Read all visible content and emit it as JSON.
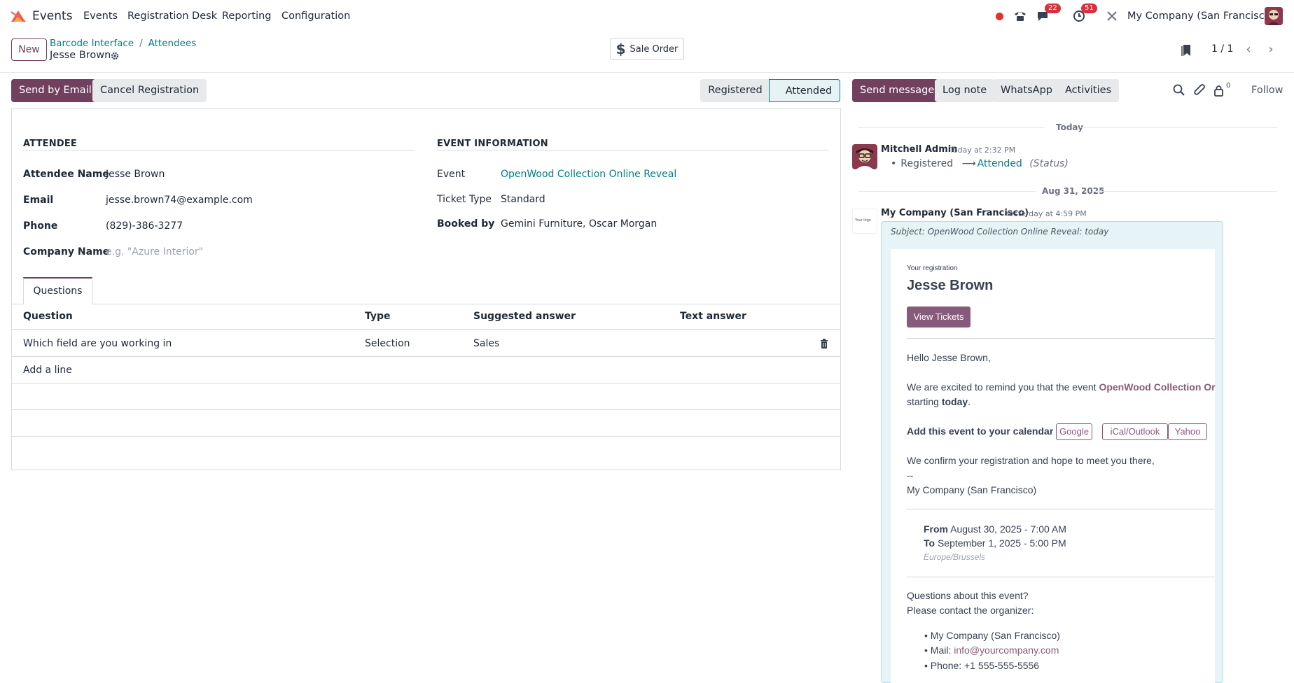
{
  "app": {
    "name": "Events"
  },
  "menu": [
    "Events",
    "Registration Desk",
    "Reporting",
    "Configuration"
  ],
  "systray": {
    "messages_badge": "22",
    "activities_badge": "51",
    "company": "My Company (San Francisco)"
  },
  "control": {
    "new_label": "New",
    "breadcrumb": [
      "Barcode Interface",
      "Attendees"
    ],
    "breadcrumb_sep": "/",
    "record_title": "Jesse Brown",
    "sale_order_label": "Sale Order",
    "pager": "1 / 1"
  },
  "statusbar": {
    "send_email": "Send by Email",
    "cancel": "Cancel Registration",
    "stages": [
      "Registered",
      "Attended"
    ],
    "active_stage": "Attended"
  },
  "form": {
    "attendee_section": "ATTENDEE",
    "event_section": "EVENT INFORMATION",
    "fields": {
      "name_label": "Attendee Name",
      "name": "Jesse Brown",
      "email_label": "Email",
      "email": "jesse.brown74@example.com",
      "phone_label": "Phone",
      "phone": "(829)-386-3277",
      "company_label": "Company Name",
      "company_placeholder": "e.g. \"Azure Interior\"",
      "event_label": "Event",
      "event": "OpenWood Collection Online Reveal",
      "ticket_label": "Ticket Type",
      "ticket": "Standard",
      "booked_label": "Booked by",
      "booked": "Gemini Furniture, Oscar Morgan"
    },
    "tab": "Questions",
    "table": {
      "headers": [
        "Question",
        "Type",
        "Suggested answer",
        "Text answer"
      ],
      "rows": [
        {
          "question": "Which field are you working in",
          "type": "Selection",
          "answer": "Sales",
          "text": ""
        }
      ],
      "add_line": "Add a line"
    }
  },
  "chatter": {
    "send_message": "Send message",
    "log_note": "Log note",
    "whatsapp": "WhatsApp",
    "activities": "Activities",
    "followers_count": "0",
    "follow": "Follow",
    "today": "Today",
    "msg1": {
      "author": "Mitchell Admin",
      "time": "Today at 2:32 PM",
      "old": "Registered",
      "new": "Attended",
      "field": "(Status)"
    },
    "date2": "Aug 31, 2025",
    "msg2": {
      "author": "My Company (San Francisco)",
      "time": "Yesterday at 4:59 PM",
      "logo_text": "Your logo",
      "subject": "Subject: OpenWood Collection Online Reveal: today",
      "your_registration": "Your registration",
      "name": "Jesse Brown",
      "view_tickets": "View Tickets",
      "hello": "Hello Jesse Brown,",
      "remind_pre": "We are excited to remind you that the event ",
      "remind_event": "OpenWood Collection Or",
      "starting": "starting ",
      "today_word": "today",
      "period": ".",
      "add_calendar": "Add this event to your calendar",
      "cal": [
        "Google",
        "iCal/Outlook",
        "Yahoo"
      ],
      "confirm": "We confirm your registration and hope to meet you there,",
      "dashes": "--",
      "signature": "My Company (San Francisco)",
      "from_label": "From",
      "from": "August 30, 2025 - 7:00 AM",
      "to_label": "To",
      "to": "September 1, 2025 - 5:00 PM",
      "tz": "Europe/Brussels",
      "questions": "Questions about this event?",
      "contact": "Please contact the organizer:",
      "contact_company": "My Company (San Francisco)",
      "mail_label": "Mail: ",
      "mail": "info@yourcompany.com",
      "phone_line": "Phone: +1 555-555-5556"
    }
  },
  "colors": {
    "brand": "#71405f",
    "link": "#017e84",
    "badge": "#d9303f",
    "mail_accent": "#875a7b"
  }
}
